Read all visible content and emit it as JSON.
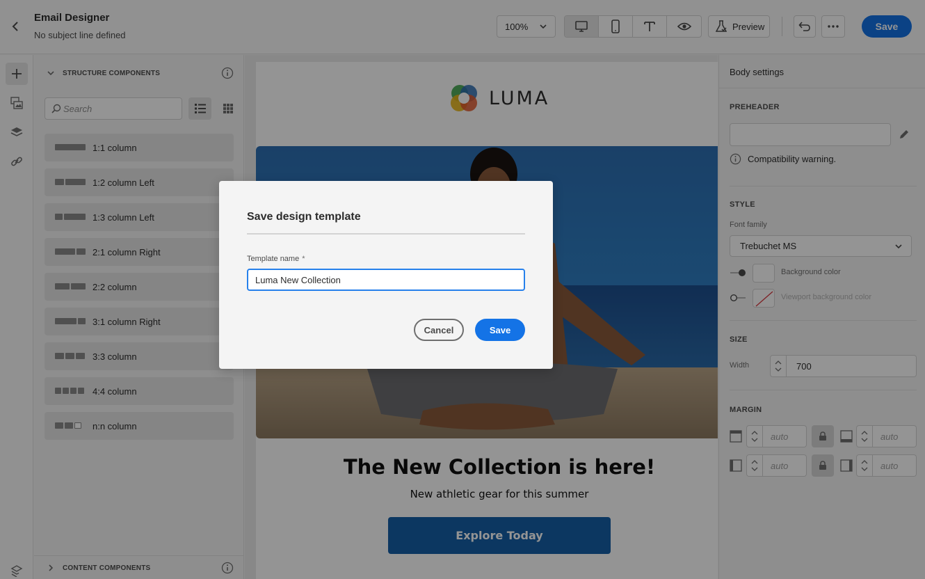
{
  "header": {
    "title": "Email Designer",
    "subtitle": "No subject line defined",
    "zoom": "100%",
    "preview_label": "Preview",
    "save_label": "Save"
  },
  "structure_components": {
    "section_label": "STRUCTURE COMPONENTS",
    "search_placeholder": "Search",
    "items": [
      {
        "label": "1:1 column",
        "icon": "layout-1-1"
      },
      {
        "label": "1:2 column Left",
        "icon": "layout-1-2-left"
      },
      {
        "label": "1:3 column Left",
        "icon": "layout-1-3-left"
      },
      {
        "label": "2:1 column Right",
        "icon": "layout-2-1-right"
      },
      {
        "label": "2:2 column",
        "icon": "layout-2-2"
      },
      {
        "label": "3:1 column Right",
        "icon": "layout-3-1-right"
      },
      {
        "label": "3:3 column",
        "icon": "layout-3-3"
      },
      {
        "label": "4:4 column",
        "icon": "layout-4-4"
      },
      {
        "label": "n:n column",
        "icon": "layout-n-n"
      }
    ]
  },
  "content_components": {
    "section_label": "CONTENT COMPONENTS"
  },
  "email": {
    "brand": "LUMA",
    "headline": "The New Collection is here!",
    "subheadline": "New athletic gear for this summer",
    "cta": "Explore Today"
  },
  "body_settings": {
    "title": "Body settings",
    "preheader_label": "PREHEADER",
    "compat_warning": "Compatibility warning.",
    "style_label": "STYLE",
    "font_family_label": "Font family",
    "font_family_value": "Trebuchet MS",
    "bg_color_label": "Background color",
    "viewport_bg_label": "Viewport background color",
    "size_label": "SIZE",
    "width_label": "Width",
    "width_value": "700",
    "margin_label": "MARGIN",
    "margin_top": "auto",
    "margin_bottom": "auto",
    "margin_left": "auto",
    "margin_right": "auto"
  },
  "dialog": {
    "title": "Save design template",
    "field_label": "Template name",
    "required_mark": "*",
    "field_value": "Luma New Collection",
    "cancel_label": "Cancel",
    "save_label": "Save"
  },
  "colors": {
    "accent": "#1473e6",
    "cta": "#1560a8"
  }
}
